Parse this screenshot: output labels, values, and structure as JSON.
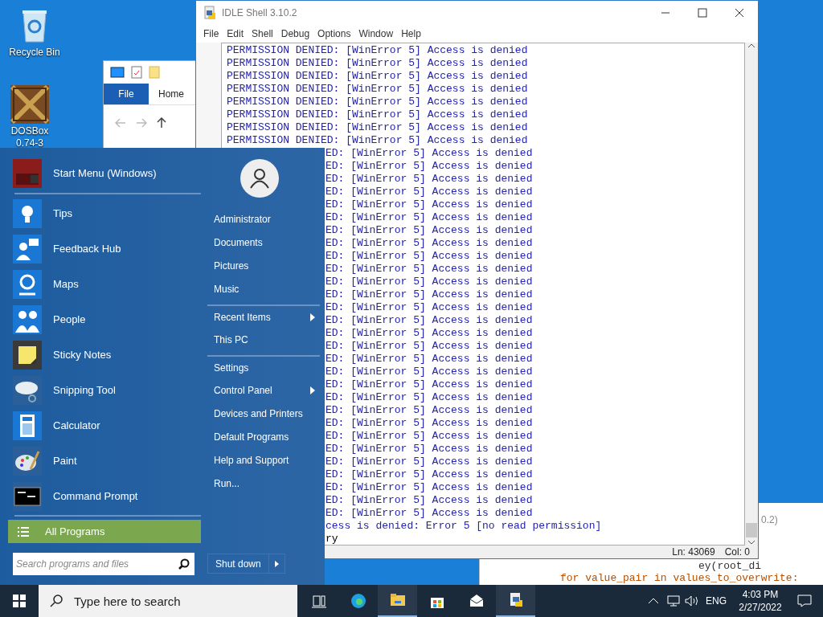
{
  "desktop_icons": [
    {
      "label": "Recycle Bin"
    },
    {
      "label": "DOSBox 0.74-3"
    }
  ],
  "explorer": {
    "tabs": [
      {
        "label": "File",
        "selected": true
      },
      {
        "label": "Home",
        "selected": false
      }
    ]
  },
  "editor_behind": {
    "title_fragment": "0.2)",
    "code_lines": [
      "ey(root_di",
      "for value_pair in values_to_overwrite:"
    ]
  },
  "idle": {
    "title": "IDLE Shell 3.10.2",
    "menu": [
      "File",
      "Edit",
      "Shell",
      "Debug",
      "Options",
      "Window",
      "Help"
    ],
    "lines": [
      {
        "kind": "error",
        "text": "PERMISSION DENIED: [WinError 5] Access is denied"
      },
      {
        "kind": "error",
        "text": "PERMISSION DENIED: [WinError 5] Access is denied"
      },
      {
        "kind": "error",
        "text": "PERMISSION DENIED: [WinError 5] Access is denied"
      },
      {
        "kind": "error",
        "text": "PERMISSION DENIED: [WinError 5] Access is denied"
      },
      {
        "kind": "error",
        "text": "PERMISSION DENIED: [WinError 5] Access is denied"
      },
      {
        "kind": "error",
        "text": "PERMISSION DENIED: [WinError 5] Access is denied"
      },
      {
        "kind": "error",
        "text": "PERMISSION DENIED: [WinError 5] Access is denied"
      },
      {
        "kind": "error",
        "text": "PERMISSION DENIED: [WinError 5] Access is denied"
      },
      {
        "kind": "error-cut",
        "text": "ED: [WinError 5] Access is denied"
      },
      {
        "kind": "error-cut",
        "text": "ED: [WinError 5] Access is denied"
      },
      {
        "kind": "error-cut",
        "text": "ED: [WinError 5] Access is denied"
      },
      {
        "kind": "error-cut",
        "text": "ED: [WinError 5] Access is denied"
      },
      {
        "kind": "error-cut",
        "text": "ED: [WinError 5] Access is denied"
      },
      {
        "kind": "error-cut",
        "text": "ED: [WinError 5] Access is denied"
      },
      {
        "kind": "error-cut",
        "text": "ED: [WinError 5] Access is denied"
      },
      {
        "kind": "error-cut",
        "text": "ED: [WinError 5] Access is denied"
      },
      {
        "kind": "error-cut",
        "text": "ED: [WinError 5] Access is denied"
      },
      {
        "kind": "error-cut",
        "text": "ED: [WinError 5] Access is denied"
      },
      {
        "kind": "error-cut",
        "text": "ED: [WinError 5] Access is denied"
      },
      {
        "kind": "error-cut",
        "text": "ED: [WinError 5] Access is denied"
      },
      {
        "kind": "error-cut",
        "text": "ED: [WinError 5] Access is denied"
      },
      {
        "kind": "error-cut",
        "text": "ED: [WinError 5] Access is denied"
      },
      {
        "kind": "error-cut",
        "text": "ED: [WinError 5] Access is denied"
      },
      {
        "kind": "error-cut",
        "text": "ED: [WinError 5] Access is denied"
      },
      {
        "kind": "error-cut",
        "text": "ED: [WinError 5] Access is denied"
      },
      {
        "kind": "error-cut",
        "text": "ED: [WinError 5] Access is denied"
      },
      {
        "kind": "error-cut",
        "text": "ED: [WinError 5] Access is denied"
      },
      {
        "kind": "error-cut",
        "text": "ED: [WinError 5] Access is denied"
      },
      {
        "kind": "error-cut",
        "text": "ED: [WinError 5] Access is denied"
      },
      {
        "kind": "error-cut",
        "text": "ED: [WinError 5] Access is denied"
      },
      {
        "kind": "error-cut",
        "text": "ED: [WinError 5] Access is denied"
      },
      {
        "kind": "error-cut",
        "text": "ED: [WinError 5] Access is denied"
      },
      {
        "kind": "error-cut",
        "text": "ED: [WinError 5] Access is denied"
      },
      {
        "kind": "error-cut",
        "text": "ED: [WinError 5] Access is denied"
      },
      {
        "kind": "error-cut",
        "text": "ED: [WinError 5] Access is denied"
      },
      {
        "kind": "error-cut",
        "text": "ED: [WinError 5] Access is denied"
      },
      {
        "kind": "error-cut",
        "text": "ED: [WinError 5] Access is denied"
      },
      {
        "kind": "error-cut",
        "text": "cess is denied: Error 5 [no read permission]"
      },
      {
        "kind": "plain-cut",
        "text": "ry"
      }
    ],
    "status": {
      "line": "Ln: 43069",
      "col": "Col: 0"
    }
  },
  "start_menu": {
    "header": "Start Menu (Windows)",
    "programs": [
      "Tips",
      "Feedback Hub",
      "Maps",
      "People",
      "Sticky Notes",
      "Snipping Tool",
      "Calculator",
      "Paint",
      "Command Prompt"
    ],
    "all_programs": "All Programs",
    "search": {
      "placeholder": "Search programs and files"
    },
    "places": [
      {
        "label": "Administrator",
        "submenu": false,
        "divider_before": false
      },
      {
        "label": "Documents",
        "submenu": false,
        "divider_before": false
      },
      {
        "label": "Pictures",
        "submenu": false,
        "divider_before": false
      },
      {
        "label": "Music",
        "submenu": false,
        "divider_before": false
      },
      {
        "label": "Recent Items",
        "submenu": true,
        "divider_before": true
      },
      {
        "label": "This PC",
        "submenu": false,
        "divider_before": false
      },
      {
        "label": "Settings",
        "submenu": false,
        "divider_before": true
      },
      {
        "label": "Control Panel",
        "submenu": true,
        "divider_before": false
      },
      {
        "label": "Devices and Printers",
        "submenu": false,
        "divider_before": false
      },
      {
        "label": "Default Programs",
        "submenu": false,
        "divider_before": false
      },
      {
        "label": "Help and Support",
        "submenu": false,
        "divider_before": false
      },
      {
        "label": "Run...",
        "submenu": false,
        "divider_before": false
      }
    ],
    "shut_down": "Shut down"
  },
  "taskbar": {
    "search_placeholder": "Type here to search",
    "apps": [
      {
        "kind": "task-view",
        "running": false
      },
      {
        "kind": "edge",
        "running": false
      },
      {
        "kind": "explorer",
        "running": true
      },
      {
        "kind": "store",
        "running": false
      },
      {
        "kind": "mail",
        "running": false
      },
      {
        "kind": "python",
        "running": true
      }
    ],
    "language": "ENG",
    "time": "4:03 PM",
    "date": "2/27/2022"
  }
}
